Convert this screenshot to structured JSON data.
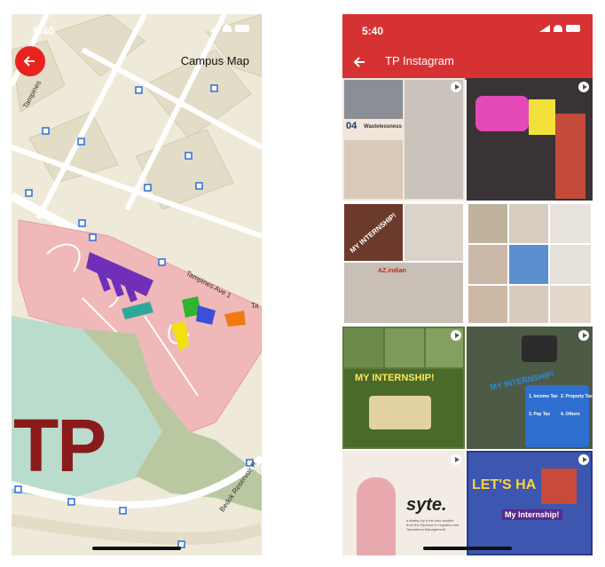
{
  "left_screen": {
    "status_time": "5:40",
    "title": "Campus Map",
    "back_icon": "arrow-left-icon",
    "road_labels": {
      "tampines_rd": "Tampines",
      "tampines_ave1": "Tampines Ave 1",
      "ta": "Ta",
      "bedok": "Bedok Reservoir R"
    },
    "campus_logo": "TP",
    "colors": {
      "back_button": "#e8231f",
      "logo": "#8b1a1a"
    }
  },
  "right_screen": {
    "status_time": "5:40",
    "title": "TP Instagram",
    "back_icon": "arrow-left-icon",
    "header_color": "#d73233",
    "tiles": [
      {
        "caption": "Wastelessness",
        "badge": "04"
      },
      {
        "caption": ""
      },
      {
        "caption": "MY INTERNSHIP!",
        "sub": "AZ.indian"
      },
      {
        "caption": ""
      },
      {
        "caption": "MY INTERNSHIP!"
      },
      {
        "caption": "MY INTERNSHIP!",
        "kiosk": [
          "1. Income Tax",
          "2. Property Tax",
          "3. Pay Tax",
          "4. Others"
        ]
      },
      {
        "caption": "syte.",
        "small": "a startup by a trio who studied from the Diploma in Logistics and Operations Management"
      },
      {
        "caption": "LET'S HA",
        "sub": "My Internship!"
      }
    ]
  }
}
